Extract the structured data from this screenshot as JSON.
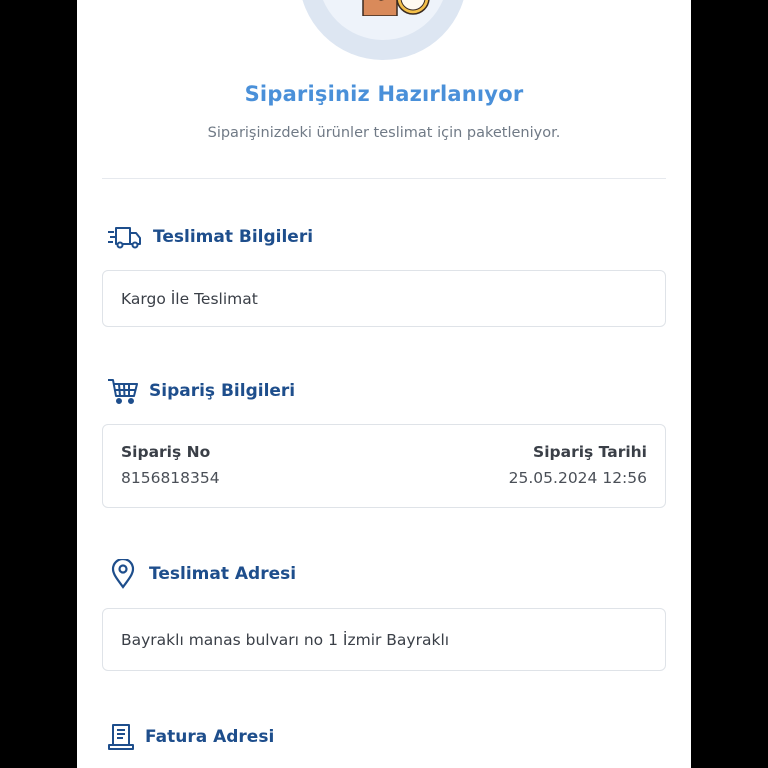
{
  "status": {
    "title": "Siparişiniz Hazırlanıyor",
    "subtitle": "Siparişinizdeki ürünler teslimat için paketleniyor."
  },
  "sections": {
    "delivery_info": {
      "title": "Teslimat Bilgileri",
      "icon": "truck-icon",
      "value": "Kargo İle Teslimat"
    },
    "order_info": {
      "title": "Sipariş Bilgileri",
      "icon": "cart-icon",
      "order_no_label": "Sipariş No",
      "order_no": "8156818354",
      "order_date_label": "Sipariş Tarihi",
      "order_date": "25.05.2024 12:56"
    },
    "delivery_address": {
      "title": "Teslimat Adresi",
      "icon": "location-pin-icon",
      "value": "Bayraklı manas bulvarı no 1 İzmir Bayraklı"
    },
    "billing_address": {
      "title": "Fatura Adresi",
      "icon": "receipt-icon"
    }
  },
  "colors": {
    "accent": "#4a90d9",
    "heading": "#1e4e8c",
    "text": "#3a3f47",
    "muted": "#707a86",
    "border": "#dfe3e8"
  }
}
